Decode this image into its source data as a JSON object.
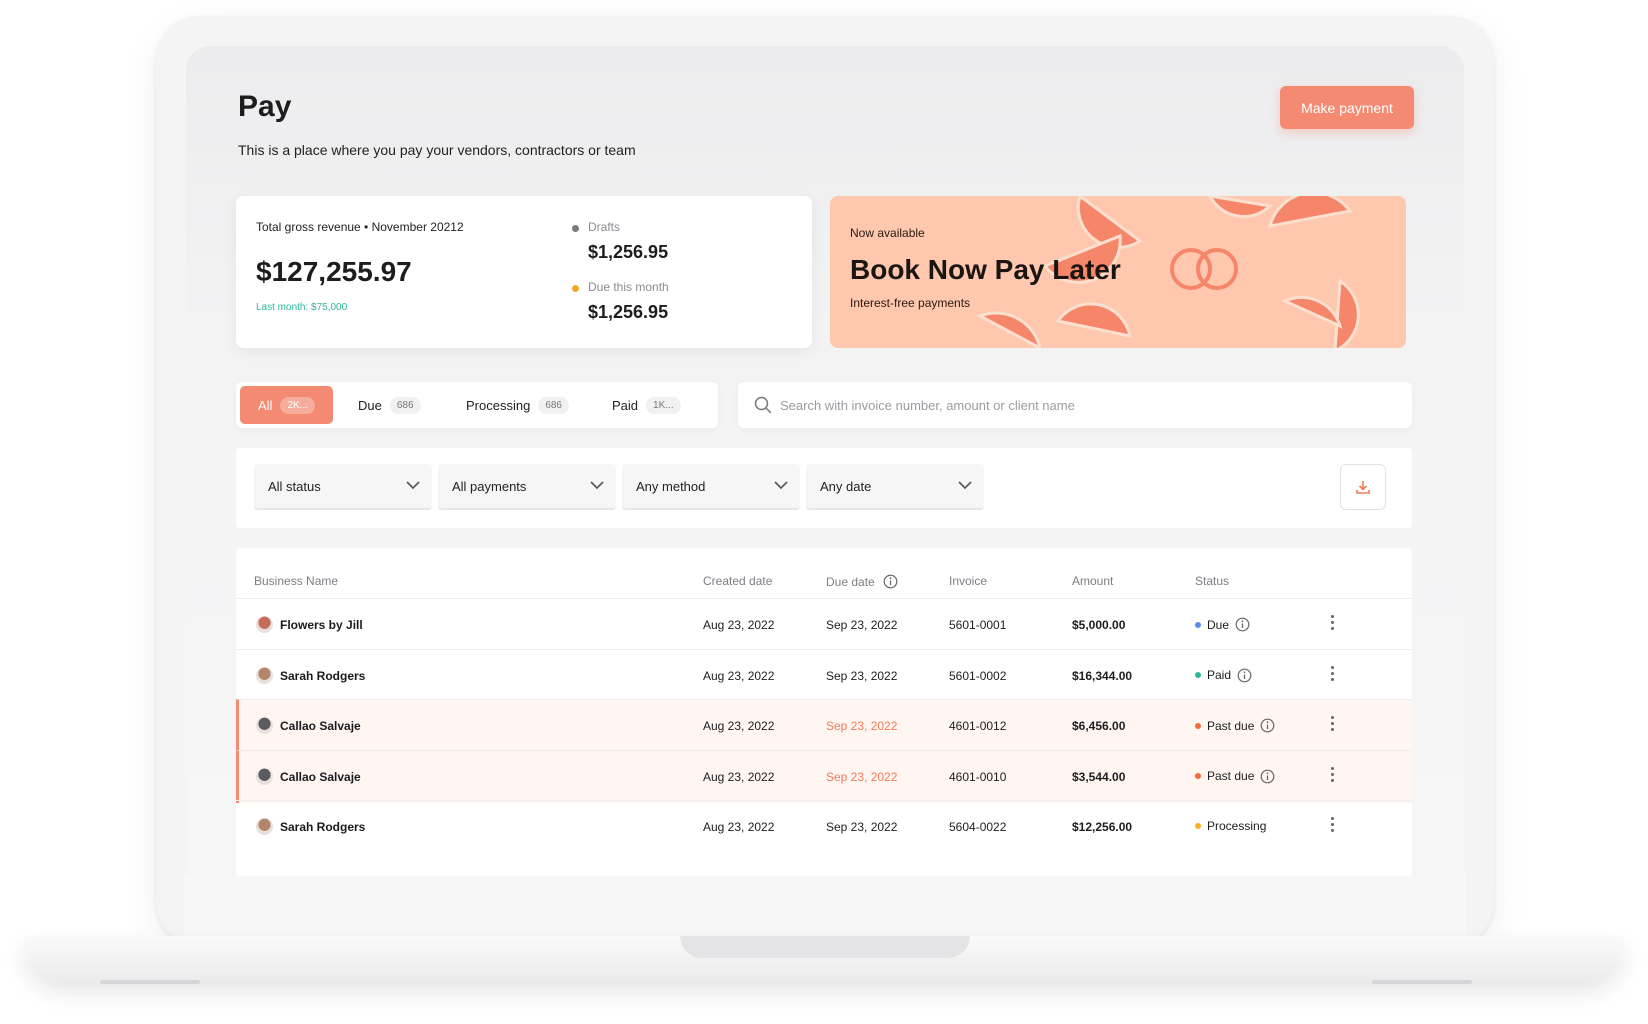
{
  "header": {
    "title": "Pay",
    "subtitle": "This is a place where you pay your vendors, contractors or team",
    "make_payment_label": "Make payment",
    "accent_color": "#f38a71"
  },
  "revenue": {
    "label": "Total gross revenue • November 20212",
    "amount": "$127,255.97",
    "last_month": "Last month: $75,000",
    "stats": [
      {
        "label": "Drafts",
        "value": "$1,256.95",
        "dot_color": "#7a7a80"
      },
      {
        "label": "Due this month",
        "value": "$1,256.95",
        "dot_color": "#f5a623"
      }
    ]
  },
  "promo": {
    "eyebrow": "Now available",
    "title": "Book Now Pay Later",
    "subtitle": "Interest-free payments",
    "background": "#ffc7ad"
  },
  "tabs": [
    {
      "label": "All",
      "count": "2K...",
      "active": true
    },
    {
      "label": "Due",
      "count": "686",
      "active": false
    },
    {
      "label": "Processing",
      "count": "686",
      "active": false
    },
    {
      "label": "Paid",
      "count": "1K...",
      "active": false
    }
  ],
  "search": {
    "placeholder": "Search with invoice number, amount or client name",
    "value": ""
  },
  "filters": {
    "status": "All status",
    "payments": "All payments",
    "method": "Any method",
    "date": "Any date",
    "download_icon": "download-icon"
  },
  "table": {
    "columns": [
      "Business Name",
      "Created date",
      "Due date",
      "Invoice",
      "Amount",
      "Status"
    ],
    "rows": [
      {
        "name": "Flowers by Jill",
        "created": "Aug 23, 2022",
        "due": "Sep 23, 2022",
        "invoice": "5601-0001",
        "amount": "$5,000.00",
        "status": "Due",
        "status_color": "#5b8def",
        "past_due": false,
        "info": true
      },
      {
        "name": "Sarah Rodgers",
        "created": "Aug 23, 2022",
        "due": "Sep 23, 2022",
        "invoice": "5601-0002",
        "amount": "$16,344.00",
        "status": "Paid",
        "status_color": "#2db89a",
        "past_due": false,
        "info": true
      },
      {
        "name": "Callao Salvaje",
        "created": "Aug 23, 2022",
        "due": "Sep 23, 2022",
        "invoice": "4601-0012",
        "amount": "$6,456.00",
        "status": "Past due",
        "status_color": "#f26b3a",
        "past_due": true,
        "info": true
      },
      {
        "name": "Callao Salvaje",
        "created": "Aug 23, 2022",
        "due": "Sep 23, 2022",
        "invoice": "4601-0010",
        "amount": "$3,544.00",
        "status": "Past due",
        "status_color": "#f26b3a",
        "past_due": true,
        "info": true
      },
      {
        "name": "Sarah Rodgers",
        "created": "Aug 23, 2022",
        "due": "Sep 23, 2022",
        "invoice": "5604-0022",
        "amount": "$12,256.00",
        "status": "Processing",
        "status_color": "#f5b223",
        "past_due": false,
        "info": false
      }
    ]
  }
}
